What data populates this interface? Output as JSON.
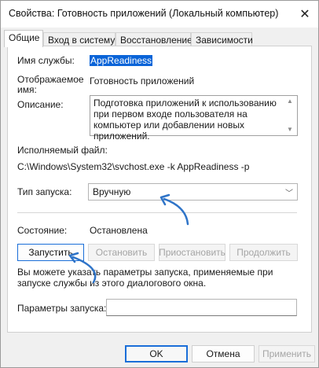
{
  "window": {
    "title": "Свойства: Готовность приложений (Локальный компьютер)",
    "close_glyph": "✕"
  },
  "tabs": [
    {
      "label": "Общие",
      "active": true
    },
    {
      "label": "Вход в систему",
      "active": false
    },
    {
      "label": "Восстановление",
      "active": false
    },
    {
      "label": "Зависимости",
      "active": false
    }
  ],
  "general": {
    "service_name_label": "Имя службы:",
    "service_name_value": "AppReadiness",
    "display_name_label_line1": "Отображаемое",
    "display_name_label_line2": "имя:",
    "display_name_value": "Готовность приложений",
    "description_label": "Описание:",
    "description_text": "Подготовка приложений к использованию при первом входе пользователя на компьютер или добавлении новых приложений.",
    "executable_label": "Исполняемый файл:",
    "executable_value": "C:\\Windows\\System32\\svchost.exe -k AppReadiness -p",
    "startup_type_label": "Тип запуска:",
    "startup_type_value": "Вручную",
    "status_label": "Состояние:",
    "status_value": "Остановлена",
    "buttons": {
      "start": "Запустить",
      "stop": "Остановить",
      "pause": "Приостановить",
      "resume": "Продолжить"
    },
    "hint_text": "Вы можете указать параметры запуска, применяемые при запуске службы из этого диалогового окна.",
    "start_params_label": "Параметры запуска:",
    "start_params_value": ""
  },
  "footer": {
    "ok": "OK",
    "cancel": "Отмена",
    "apply": "Применить"
  },
  "colors": {
    "accent": "#1a6ed8",
    "selection": "#0a64d8",
    "arrow": "#2f74c8"
  }
}
